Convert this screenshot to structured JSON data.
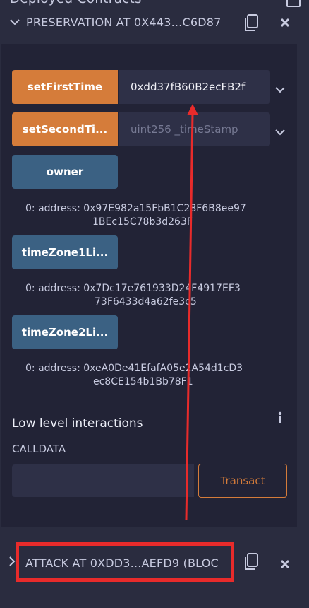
{
  "top_cut_title": "Deployed Contracts",
  "contract1": {
    "title": "PRESERVATION AT 0X443...C6D87",
    "functions": [
      {
        "label": "setFirstTime",
        "value": "0xdd37fB60B2ecFB2f",
        "placeholder": ""
      },
      {
        "label": "setSecondTi...",
        "value": "",
        "placeholder": "uint256 _timeStamp"
      }
    ],
    "views": [
      {
        "label": "owner",
        "result_line1": "0:  address: 0x97E982a15FbB1C28F6B8ee97",
        "result_line2": "1BEc15C78b3d263F"
      },
      {
        "label": "timeZone1Li...",
        "result_line1": "0:   address: 0x7Dc17e761933D24F4917EF3",
        "result_line2": "73F6433d4a62fe3c5"
      },
      {
        "label": "timeZone2Li...",
        "result_line1": "0:  address: 0xeA0De41EfafA05e2A54d1cD3",
        "result_line2": "ec8CE154b1Bb78F1"
      }
    ],
    "low_level": {
      "title": "Low level interactions",
      "calldata_label": "CALLDATA",
      "calldata_value": "",
      "transact_label": "Transact"
    }
  },
  "contract2": {
    "title": "ATTACK AT 0XDD3...AEFD9 (BLOC"
  },
  "colors": {
    "background": "#2a2c3f",
    "panel": "#222336",
    "transact_accent": "#d57c3a",
    "call_button": "#3b6183",
    "annotation": "#e82b2b"
  },
  "icons": [
    "chevron-down-icon",
    "chevron-right-icon",
    "copy-icon",
    "close-icon",
    "info-icon"
  ]
}
